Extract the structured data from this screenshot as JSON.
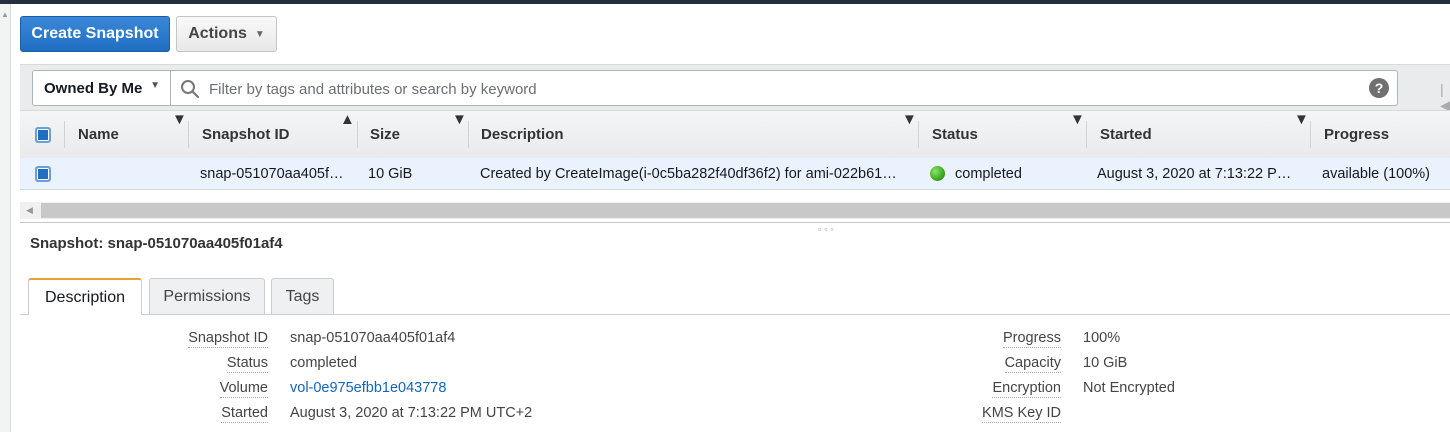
{
  "toolbar": {
    "create_label": "Create Snapshot",
    "actions_label": "Actions"
  },
  "filter": {
    "owner_select": "Owned By Me",
    "search_placeholder": "Filter by tags and attributes or search by keyword",
    "help": "?"
  },
  "table": {
    "columns": [
      "Name",
      "Snapshot ID",
      "Size",
      "Description",
      "Status",
      "Started",
      "Progress"
    ],
    "rows": [
      {
        "name": "",
        "snapshot_id": "snap-051070aa405f…",
        "size": "10 GiB",
        "description": "Created by CreateImage(i-0c5ba282f40df36f2) for ami-022b61…",
        "status": "completed",
        "started": "August 3, 2020 at 7:13:22 P…",
        "progress": "available (100%)"
      }
    ]
  },
  "detail": {
    "title": "Snapshot: snap-051070aa405f01af4",
    "tabs": [
      "Description",
      "Permissions",
      "Tags"
    ],
    "left": [
      {
        "label": "Snapshot ID",
        "value": "snap-051070aa405f01af4"
      },
      {
        "label": "Status",
        "value": "completed"
      },
      {
        "label": "Volume",
        "value": "vol-0e975efbb1e043778"
      },
      {
        "label": "Started",
        "value": "August 3, 2020 at 7:13:22 PM UTC+2"
      }
    ],
    "right": [
      {
        "label": "Progress",
        "value": "100%"
      },
      {
        "label": "Capacity",
        "value": "10 GiB"
      },
      {
        "label": "Encryption",
        "value": "Not Encrypted"
      },
      {
        "label": "KMS Key ID",
        "value": ""
      }
    ]
  },
  "colors": {
    "primary_button": "#1f6ec2",
    "selected_row": "#eaf3fd",
    "status_ok": "#2f9e16",
    "active_tab_accent": "#e7a32f",
    "link": "#1166bb"
  },
  "icons": [
    "search-icon",
    "help-icon",
    "chevron-down-icon",
    "sort-asc-icon",
    "status-ok-icon",
    "scroll-left-icon"
  ]
}
